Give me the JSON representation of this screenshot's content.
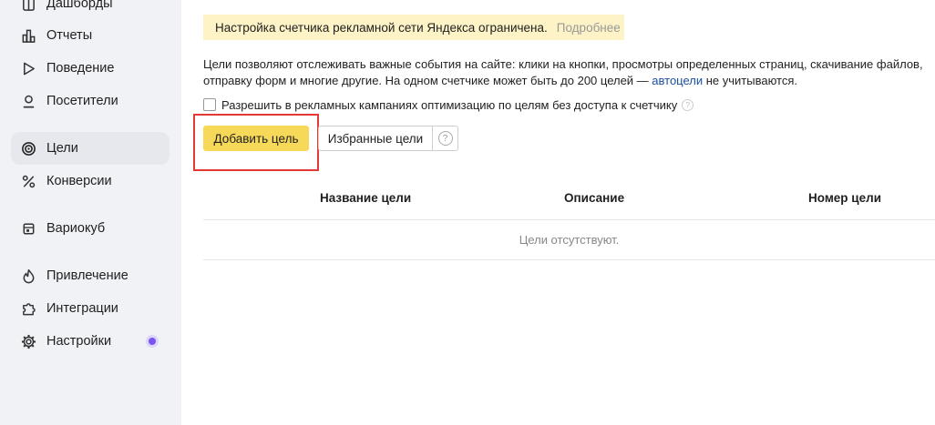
{
  "sidebar": {
    "items": [
      {
        "label": "Дашборды",
        "icon": "dashboard-icon"
      },
      {
        "label": "Отчеты",
        "icon": "reports-icon"
      },
      {
        "label": "Поведение",
        "icon": "play-icon"
      },
      {
        "label": "Посетители",
        "icon": "user-icon"
      },
      {
        "label": "Цели",
        "icon": "target-icon",
        "active": true
      },
      {
        "label": "Конверсии",
        "icon": "percent-icon"
      },
      {
        "label": "Вариокуб",
        "icon": "variocube-icon"
      },
      {
        "label": "Привлечение",
        "icon": "flame-icon"
      },
      {
        "label": "Интеграции",
        "icon": "puzzle-icon"
      },
      {
        "label": "Настройки",
        "icon": "gear-icon"
      }
    ]
  },
  "notice": {
    "text": "Настройка счетчика рекламной сети Яндекса ограничена.",
    "link": "Подробнее"
  },
  "description": {
    "text_before": "Цели позволяют отслеживать важные события на сайте: клики на кнопки, просмотры определенных страниц, скачивание файлов, отправку форм и многие другие. На одном счетчике может быть до 200 целей — ",
    "link": "автоцели",
    "text_after": " не учитываются."
  },
  "checkbox": {
    "label": "Разрешить в рекламных кампаниях оптимизацию по целям без доступа к счетчику",
    "checked": false
  },
  "buttons": {
    "add": "Добавить цель",
    "favorites": "Избранные цели",
    "help": "?"
  },
  "table": {
    "columns": [
      "Название цели",
      "Описание",
      "Номер цели"
    ],
    "empty_text": "Цели отсутствуют."
  },
  "colors": {
    "accent_button": "#f7d959",
    "notice_bg": "#fdf3c6",
    "highlight_frame": "#e53935",
    "settings_dot": "#7a55f2"
  }
}
